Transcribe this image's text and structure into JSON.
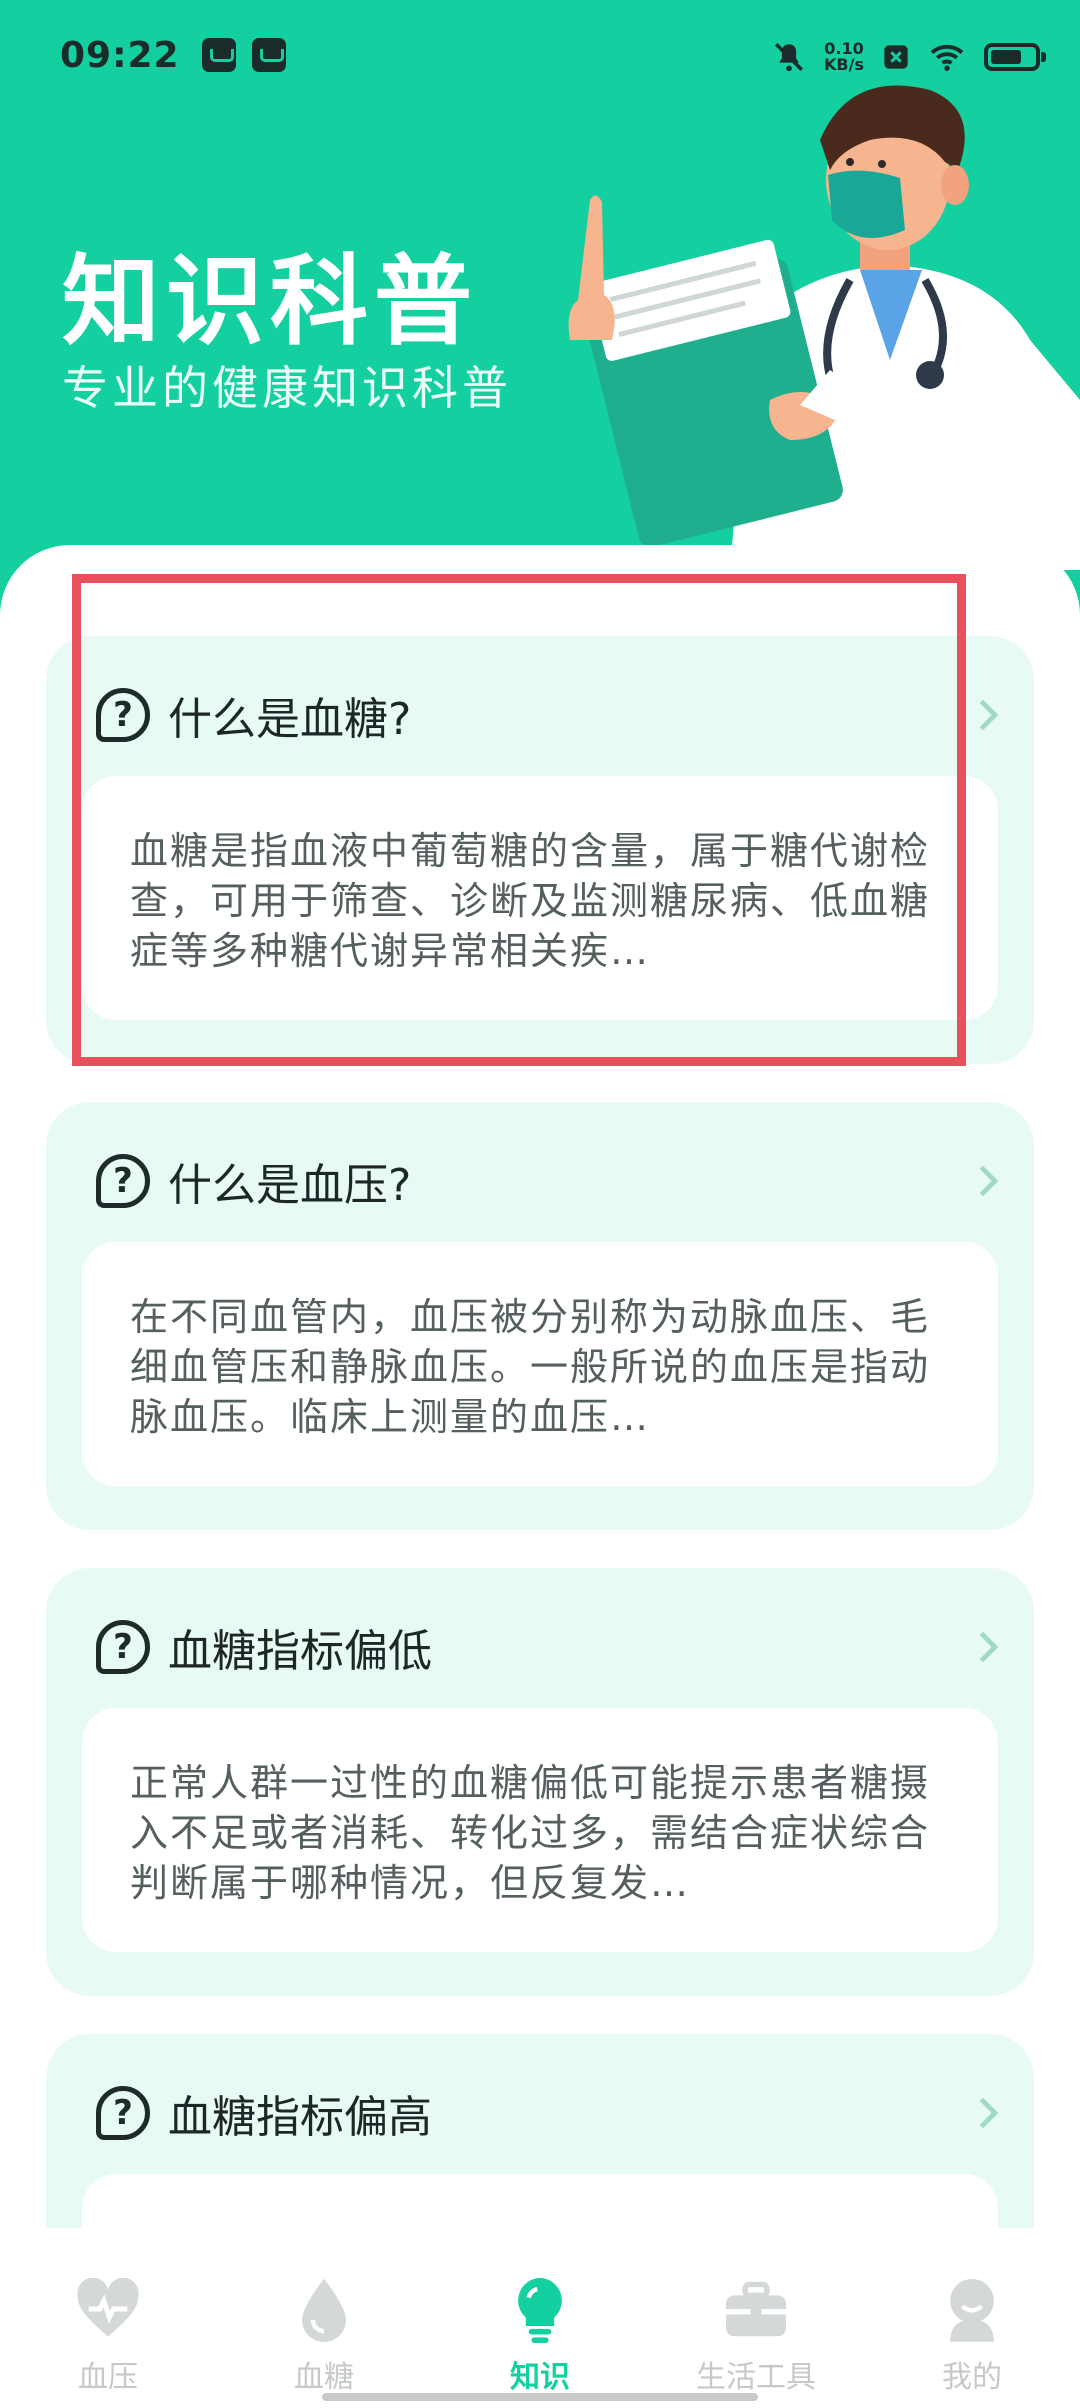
{
  "status_bar": {
    "time": "09:22",
    "net_speed_top": "0.10",
    "net_speed_bottom": "KB/s",
    "icons": [
      "message-icon",
      "wallet-icon",
      "mute-icon",
      "close-box-icon",
      "wifi-icon",
      "battery-icon"
    ]
  },
  "header": {
    "title": "知识科普",
    "subtitle": "专业的健康知识科普"
  },
  "articles": [
    {
      "title": "什么是血糖?",
      "summary": "血糖是指血液中葡萄糖的含量，属于糖代谢检查，可用于筛查、诊断及监测糖尿病、低血糖症等多种糖代谢异常相关疾…"
    },
    {
      "title": "什么是血压?",
      "summary": "在不同血管内，血压被分别称为动脉血压、毛细血管压和静脉血压。一般所说的血压是指动脉血压。临床上测量的血压…"
    },
    {
      "title": "血糖指标偏低",
      "summary": "正常人群一过性的血糖偏低可能提示患者糖摄入不足或者消耗、转化过多，需结合症状综合判断属于哪种情况，但反复发…"
    },
    {
      "title": "血糖指标偏高",
      "summary": ""
    }
  ],
  "nav": {
    "items": [
      {
        "label": "血压",
        "icon": "heart-pulse-icon"
      },
      {
        "label": "血糖",
        "icon": "drop-icon"
      },
      {
        "label": "知识",
        "icon": "lightbulb-icon"
      },
      {
        "label": "生活工具",
        "icon": "toolbox-icon"
      },
      {
        "label": "我的",
        "icon": "profile-icon"
      }
    ],
    "active": "知识"
  },
  "colors": {
    "primary": "#14cfa0",
    "card_bg": "#e8faf4",
    "highlight": "#e8505b",
    "nav_inactive": "#c6c9ca"
  }
}
